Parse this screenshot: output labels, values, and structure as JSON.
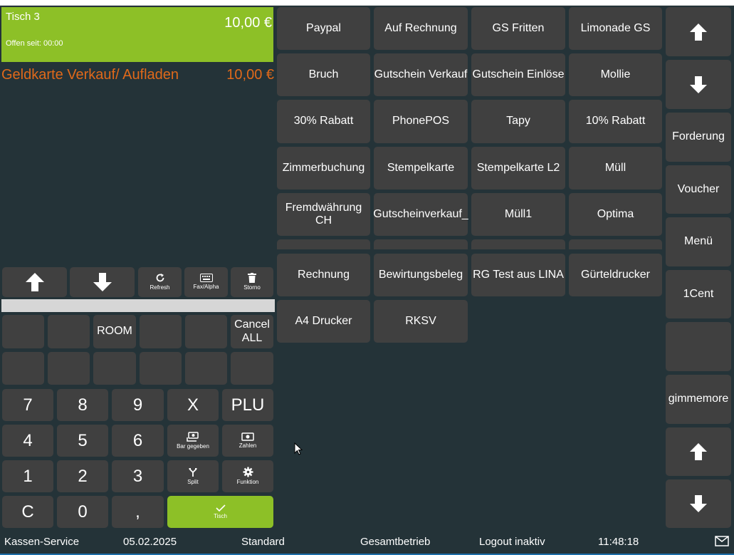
{
  "ticket": {
    "name": "Tisch 3",
    "total": "10,00 €",
    "open_since": "Offen seit: 00:00"
  },
  "order_items": [
    {
      "label": "Geldkarte Verkauf/ Aufladen",
      "price": "10,00 €"
    }
  ],
  "ticket_toolbar": {
    "refresh": "Refresh",
    "fax_alpha": "Fax/Alpha",
    "storno": "Storno"
  },
  "keypad": {
    "room": "ROOM",
    "cancel_line1": "Cancel",
    "cancel_line2": "ALL",
    "k7": "7",
    "k8": "8",
    "k9": "9",
    "x": "X",
    "plu": "PLU",
    "k4": "4",
    "k5": "5",
    "k6": "6",
    "bar_gegeben": "Bar gegeben",
    "zahlen": "Zahlen",
    "k1": "1",
    "k2": "2",
    "k3": "3",
    "split": "Split",
    "funktion": "Funktion",
    "c": "C",
    "k0": "0",
    "comma": ",",
    "tisch": "Tisch"
  },
  "payment_buttons": [
    "Paypal",
    "Auf Rechnung",
    "GS Fritten",
    "Limonade GS",
    "Bruch",
    "Gutschein Verkauf",
    "Gutschein Einlöse",
    "Mollie",
    "30% Rabatt",
    "PhonePOS",
    "Tapy",
    "10% Rabatt",
    "Zimmerbuchung",
    "Stempelkarte",
    "Stempelkarte L2",
    "Müll",
    "Fremdwährung CH",
    "Gutscheinverkauf_",
    "Müll1",
    "Optima"
  ],
  "print_buttons": [
    "Rechnung",
    "Bewirtungsbeleg",
    "RG Test aus LINA",
    "Gürteldrucker",
    "A4 Drucker",
    "RKSV"
  ],
  "side_menu": {
    "forderung": "Forderung",
    "voucher": "Voucher",
    "menu": "Menü",
    "one_cent": "1Cent",
    "gimmemore": "gimmemore"
  },
  "status_bar": {
    "service": "Kassen-Service",
    "date": "05.02.2025",
    "mode": "Standard",
    "scope": "Gesamtbetrieb",
    "logout": "Logout inaktiv",
    "time": "11:48:18"
  },
  "colors": {
    "background": "#243338",
    "button": "#404040",
    "accent_green": "#8dc027",
    "item_orange": "#e0691a",
    "status_accent": "#1c6ea8"
  }
}
